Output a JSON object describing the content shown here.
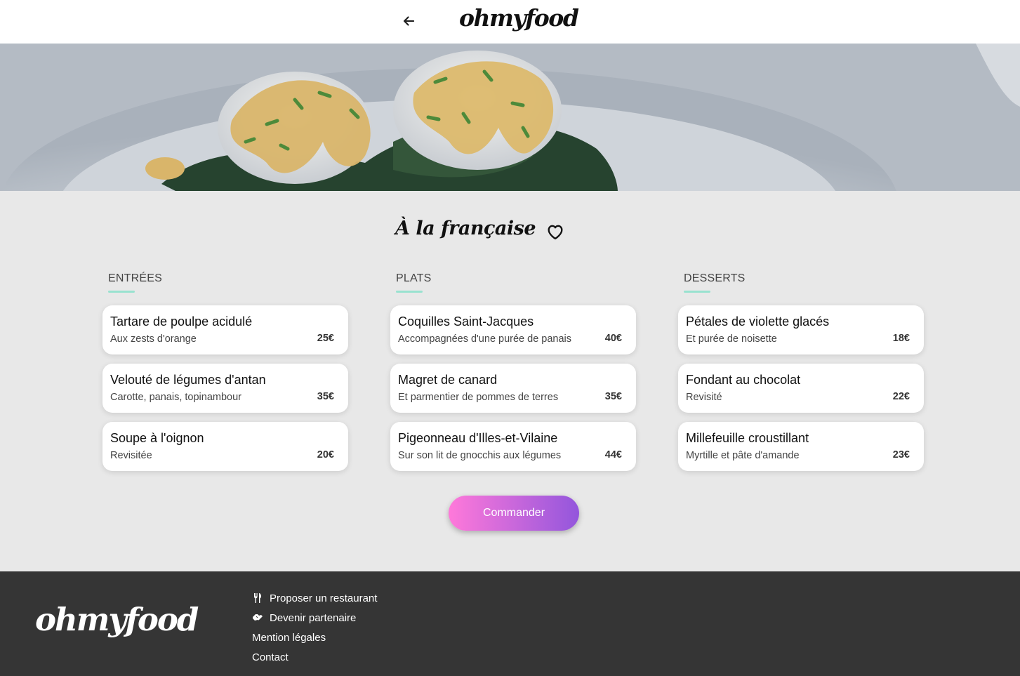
{
  "header": {
    "back_icon": "arrow-left-icon",
    "logo": "ohmyfood"
  },
  "hero": {
    "alt_subject": "poached eggs with hollandaise sauce and chives on spinach"
  },
  "restaurant": {
    "title": "À la française",
    "favorite_icon": "heart-outline-icon"
  },
  "menu": {
    "columns": [
      {
        "heading": "ENTRÉES",
        "items": [
          {
            "name": "Tartare de poulpe acidulé",
            "description": "Aux zests d'orange",
            "price": "25€"
          },
          {
            "name": "Velouté de légumes d'antan",
            "description": "Carotte, panais, topinambour",
            "price": "35€"
          },
          {
            "name": "Soupe à l'oignon",
            "description": "Revisitée",
            "price": "20€"
          }
        ]
      },
      {
        "heading": "PLATS",
        "items": [
          {
            "name": "Coquilles Saint-Jacques",
            "description": "Accompagnées d'une purée de panais",
            "price": "40€"
          },
          {
            "name": "Magret de canard",
            "description": "Et parmentier de pommes de terres",
            "price": "35€"
          },
          {
            "name": "Pigeonneau d'Illes-et-Vilaine",
            "description": "Sur son lit de gnocchis aux légumes",
            "price": "44€"
          }
        ]
      },
      {
        "heading": "DESSERTS",
        "items": [
          {
            "name": "Pétales de violette glacés",
            "description": "Et purée de noisette",
            "price": "18€"
          },
          {
            "name": "Fondant au chocolat",
            "description": "Revisité",
            "price": "22€"
          },
          {
            "name": "Millefeuille croustillant",
            "description": "Myrtille et pâte d'amande",
            "price": "23€"
          }
        ]
      }
    ]
  },
  "order_button": {
    "label": "Commander"
  },
  "footer": {
    "logo": "ohmyfood",
    "links": [
      {
        "label": "Proposer un restaurant",
        "icon": "utensils-icon"
      },
      {
        "label": "Devenir partenaire",
        "icon": "handshake-icon"
      },
      {
        "label": "Mention légales",
        "icon": ""
      },
      {
        "label": "Contact",
        "icon": ""
      }
    ]
  },
  "colors": {
    "accent_underline": "#99e2d0",
    "button_gradient_start": "#ff79da",
    "button_gradient_end": "#9356dc",
    "footer_bg": "#353535",
    "page_bg": "#e8e8e8"
  }
}
